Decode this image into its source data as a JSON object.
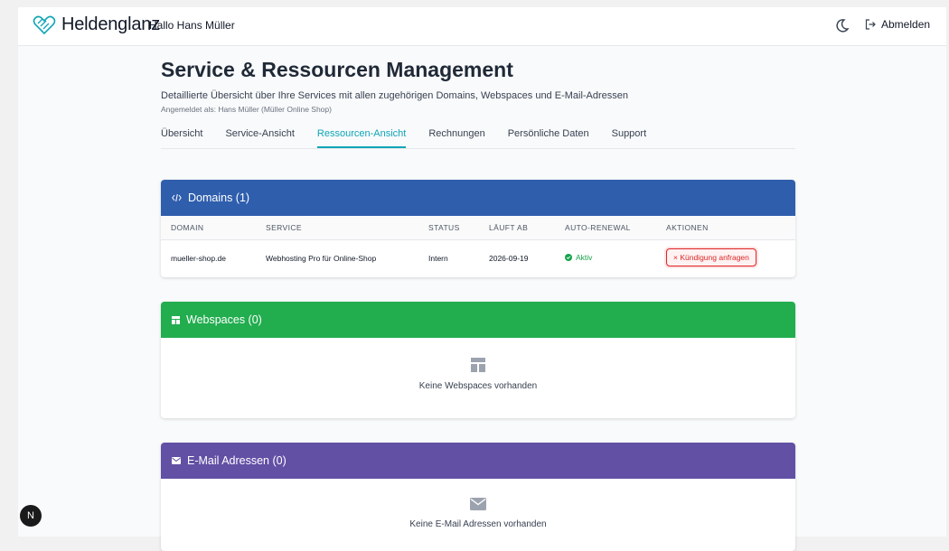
{
  "header": {
    "brand": "Heldenglanz",
    "greeting": "Hallo Hans Müller",
    "logout_label": "Abmelden"
  },
  "main": {
    "title": "Service & Ressourcen Management",
    "subtitle": "Detaillierte Übersicht über Ihre Services mit allen zugehörigen Domains, Webspaces und E-Mail-Adressen",
    "logged_in": "Angemeldet als: Hans Müller (Müller Online Shop)",
    "tabs": [
      {
        "label": "Übersicht"
      },
      {
        "label": "Service-Ansicht"
      },
      {
        "label": "Ressourcen-Ansicht",
        "active": true
      },
      {
        "label": "Rechnungen"
      },
      {
        "label": "Persönliche Daten"
      },
      {
        "label": "Support"
      }
    ]
  },
  "domains": {
    "title": "Domains (1)",
    "color": "#2f5ead",
    "columns": [
      "DOMAIN",
      "SERVICE",
      "STATUS",
      "LÄUFT AB",
      "AUTO-RENEWAL",
      "AKTIONEN"
    ],
    "rows": [
      {
        "domain": "mueller-shop.de",
        "service": "Webhosting Pro für Online-Shop",
        "status": "Intern",
        "expires": "2026-09-19",
        "auto_renewal": "Aktiv",
        "action": "× Kündigung anfragen"
      }
    ]
  },
  "webspaces": {
    "title": "Webspaces (0)",
    "color": "#22ad4f",
    "empty_text": "Keine Webspaces vorhanden"
  },
  "email": {
    "title": "E-Mail Adressen (0)",
    "color": "#6250a5",
    "empty_text": "Keine E-Mail Adressen vorhanden"
  },
  "badge": {
    "letter": "N"
  },
  "colors": {
    "accent": "#0ea5b7",
    "danger": "#dc2626",
    "success": "#16a34a"
  }
}
